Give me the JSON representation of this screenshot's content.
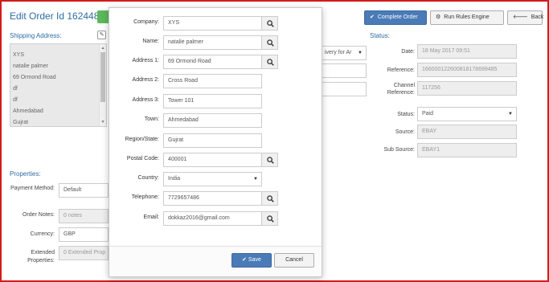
{
  "page": {
    "title": "Edit Order Id 162448",
    "shipping_address_label": "Shipping Address:",
    "address_lines": [
      "XYS",
      "natalie palmer",
      "69 Ormond Road",
      "df",
      "df",
      "Ahmedabad",
      "Gujrat"
    ],
    "properties_label": "Properties:",
    "properties": {
      "payment_method_label": "Payment Method:",
      "payment_method_value": "Default",
      "order_notes_label": "Order Notes:",
      "order_notes_value": "0 notes",
      "currency_label": "Currency:",
      "currency_value": "GBP",
      "extended_label": "Extended Properties:",
      "extended_value": "0 Extended Prop"
    },
    "middle_select_value": "ivery for Ar"
  },
  "toolbar": {
    "complete_order": "Complete Order",
    "run_rules": "Run Rules Engine",
    "back": "Back"
  },
  "status": {
    "heading": "Status:",
    "date_label": "Date:",
    "date_value": "18 May 2017 09:51",
    "reference_label": "Reference:",
    "reference_value": "166000122600818178699485",
    "channel_reference_label": "Channel Reference:",
    "channel_reference_value": "117256",
    "status_label": "Status:",
    "status_value": "Paid",
    "source_label": "Source:",
    "source_value": "EBAY",
    "sub_source_label": "Sub Source:",
    "sub_source_value": "EBAY1"
  },
  "modal": {
    "company_label": "Company:",
    "company_value": "XYS",
    "name_label": "Name:",
    "name_value": "natalie palmer",
    "address1_label": "Address 1:",
    "address1_value": "69 Ormond Road",
    "address2_label": "Address 2:",
    "address2_value": "Cross Road",
    "address3_label": "Address 3:",
    "address3_value": "Tower 101",
    "town_label": "Town:",
    "town_value": "Ahmedabad",
    "region_label": "Region/State:",
    "region_value": "Gujrat",
    "postal_label": "Postal Code:",
    "postal_value": "400001",
    "country_label": "Country:",
    "country_value": "India",
    "telephone_label": "Telephone:",
    "telephone_value": "7729657486",
    "email_label": "Email:",
    "email_value": "dokkaz2016@gmail.com",
    "save": "Save",
    "cancel": "Cancel"
  },
  "colors": {
    "frame": "#d01c1c",
    "primary": "#4a7bb7",
    "heading_blue": "#2e6da4",
    "green": "#5cb85c"
  },
  "icons": [
    "search-icon",
    "check-icon",
    "gears-icon",
    "arrow-left-icon",
    "edit-icon",
    "chevron-down-icon"
  ]
}
